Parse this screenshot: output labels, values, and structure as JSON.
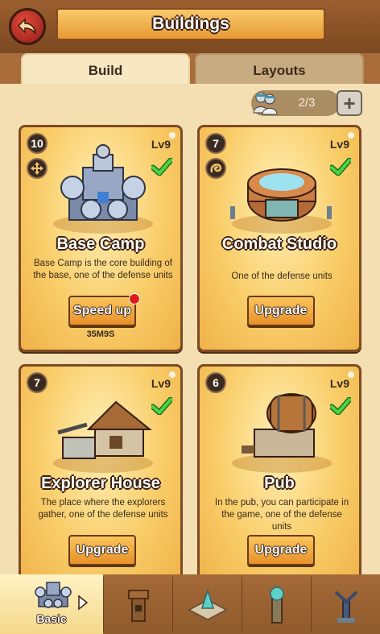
{
  "header": {
    "title": "Buildings"
  },
  "tabs": [
    {
      "label": "Build",
      "active": true
    },
    {
      "label": "Layouts",
      "active": false
    }
  ],
  "counter": {
    "value": "2/3",
    "add_symbol": "+"
  },
  "cards": [
    {
      "name": "Base Camp",
      "badge": "10",
      "level": "Lv9",
      "description": "Base Camp is the core building of the base, one of the defense units",
      "button": "Speed up",
      "timer": "35M9S",
      "icon": "move-arrows-icon",
      "notification": true
    },
    {
      "name": "Combat Studio",
      "badge": "7",
      "level": "Lv9",
      "description": "One of the defense units",
      "button": "Upgrade",
      "icon": "swirl-icon"
    },
    {
      "name": "Explorer House",
      "badge": "7",
      "level": "Lv9",
      "description": "The place where the explorers gather, one of the defense units",
      "button": "Upgrade"
    },
    {
      "name": "Pub",
      "badge": "6",
      "level": "Lv9",
      "description": "In the pub, you can participate in the game, one of the defense units",
      "button": "Upgrade"
    }
  ],
  "bottom_nav": {
    "active_label": "Basic",
    "categories": [
      "basic",
      "tower",
      "fountain",
      "beacon",
      "turret"
    ]
  },
  "colors": {
    "card_gold": "#f9cd69",
    "button_orange": "#e7902a",
    "check_green": "#3fc13a",
    "panel_bg": "#f4dfb2"
  }
}
